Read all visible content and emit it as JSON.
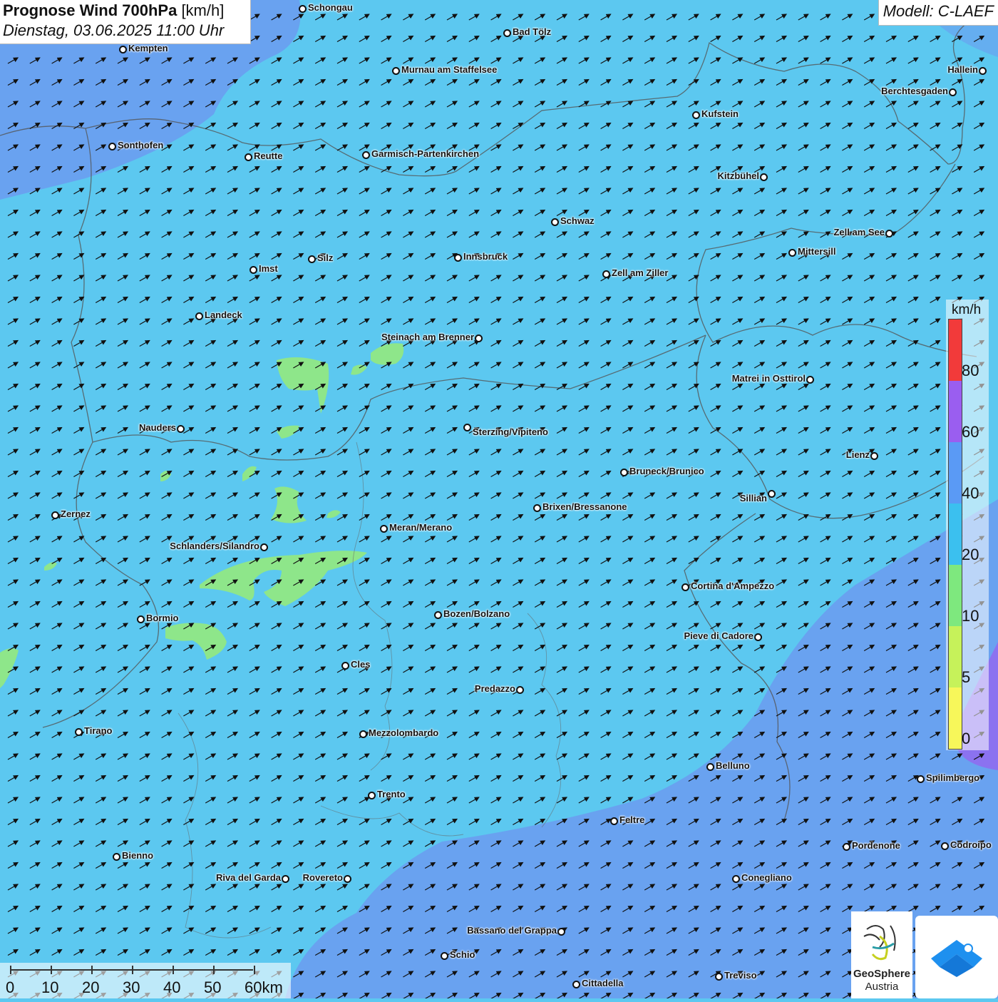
{
  "header": {
    "title_bold": "Prognose Wind 700hPa",
    "title_unit": "[km/h]",
    "datetime": "Dienstag, 03.06.2025 11:00 Uhr",
    "model": "Modell: C-LAEF"
  },
  "cities": [
    {
      "name": "Schongau"
    },
    {
      "name": "Bad Tölz"
    },
    {
      "name": "Kempten"
    },
    {
      "name": "Murnau am Staffelsee"
    },
    {
      "name": "Hallein"
    },
    {
      "name": "Berchtesgaden"
    },
    {
      "name": "Kufstein"
    },
    {
      "name": "Sonthofen"
    },
    {
      "name": "Reutte"
    },
    {
      "name": "Garmisch-Partenkirchen"
    },
    {
      "name": "Kitzbühel"
    },
    {
      "name": "Schwaz"
    },
    {
      "name": "Zell am See"
    },
    {
      "name": "Mittersill"
    },
    {
      "name": "Innsbruck"
    },
    {
      "name": "Imst"
    },
    {
      "name": "Silz"
    },
    {
      "name": "Zell am Ziller"
    },
    {
      "name": "Landeck"
    },
    {
      "name": "Steinach am Brenner"
    },
    {
      "name": "Matrei in Osttirol"
    },
    {
      "name": "Nauders"
    },
    {
      "name": "Sterzing/Vipiteno"
    },
    {
      "name": "Lienz"
    },
    {
      "name": "Bruneck/Brunico"
    },
    {
      "name": "Sillian"
    },
    {
      "name": "Zernez"
    },
    {
      "name": "Brixen/Bressanone"
    },
    {
      "name": "Meran/Merano"
    },
    {
      "name": "Schlanders/Silandro"
    },
    {
      "name": "Cortina d'Ampezzo"
    },
    {
      "name": "Bozen/Bolzano"
    },
    {
      "name": "Bormio"
    },
    {
      "name": "Pieve di Cadore"
    },
    {
      "name": "Cles"
    },
    {
      "name": "Predazzo"
    },
    {
      "name": "Tirano"
    },
    {
      "name": "Mezzolombardo"
    },
    {
      "name": "Belluno"
    },
    {
      "name": "Spilimbergo"
    },
    {
      "name": "Trento"
    },
    {
      "name": "Feltre"
    },
    {
      "name": "Pordenone"
    },
    {
      "name": "Codroipo"
    },
    {
      "name": "Bienno"
    },
    {
      "name": "Riva del Garda"
    },
    {
      "name": "Rovereto"
    },
    {
      "name": "Conegliano"
    },
    {
      "name": "Bassano del Grappa"
    },
    {
      "name": "Schio"
    },
    {
      "name": "Treviso"
    },
    {
      "name": "Cittadella"
    }
  ],
  "legend": {
    "unit": "km/h",
    "classes": [
      {
        "label": "80",
        "color": "#f23a3a"
      },
      {
        "label": "60",
        "color": "#9a5ef0"
      },
      {
        "label": "40",
        "color": "#5a9af5"
      },
      {
        "label": "20",
        "color": "#3bc0ef"
      },
      {
        "label": "10",
        "color": "#7ee87e"
      },
      {
        "label": "5",
        "color": "#c6f25a"
      },
      {
        "label": "0",
        "color": "#f7f75a"
      }
    ]
  },
  "scale": {
    "ticks": [
      "0",
      "10",
      "20",
      "30",
      "40",
      "50",
      "60km"
    ]
  },
  "logos": {
    "geosphere_name": "GeoSphere",
    "geosphere_sub": "Austria"
  },
  "wind": {
    "direction": "towards north-east",
    "predominant_class": "20"
  }
}
